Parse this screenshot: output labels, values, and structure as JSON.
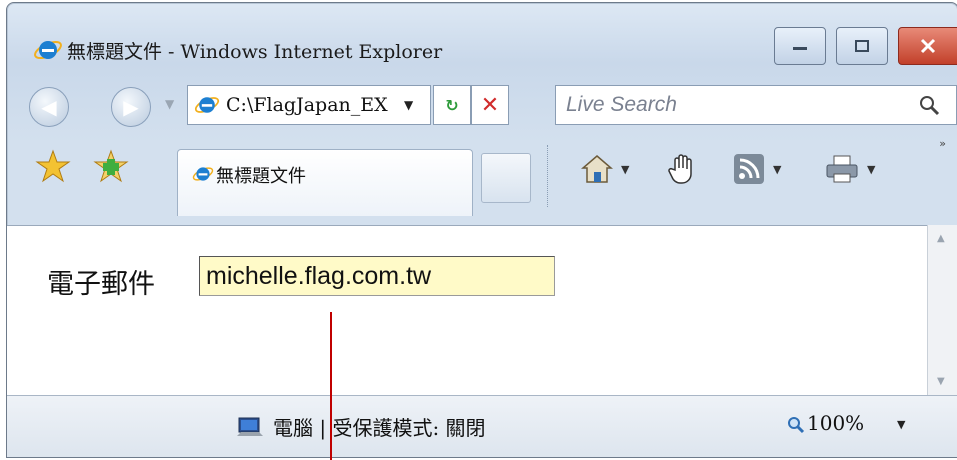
{
  "window": {
    "title": "無標題文件 - Windows Internet Explorer"
  },
  "nav": {
    "address": "C:\\FlagJapan_EX",
    "search_placeholder": "Live Search",
    "refresh_symbol": "↻",
    "stop_symbol": "✕"
  },
  "tab": {
    "label": "無標題文件"
  },
  "content": {
    "email_label": "電子郵件",
    "email_value": "michelle.flag.com.tw"
  },
  "status": {
    "zone_text": "電腦 | 受保護模式: 關閉",
    "zoom": "100%"
  },
  "icons": [
    "ie-logo-icon",
    "back-icon",
    "forward-icon",
    "refresh-icon",
    "stop-icon",
    "search-icon",
    "favorites-star-icon",
    "add-favorites-icon",
    "home-icon",
    "hand-icon",
    "rss-icon",
    "print-icon",
    "computer-icon",
    "zoom-icon"
  ],
  "colors": {
    "input_highlight": "#fffac8",
    "callout_line": "#c00000",
    "close_button": "#c2402a"
  }
}
